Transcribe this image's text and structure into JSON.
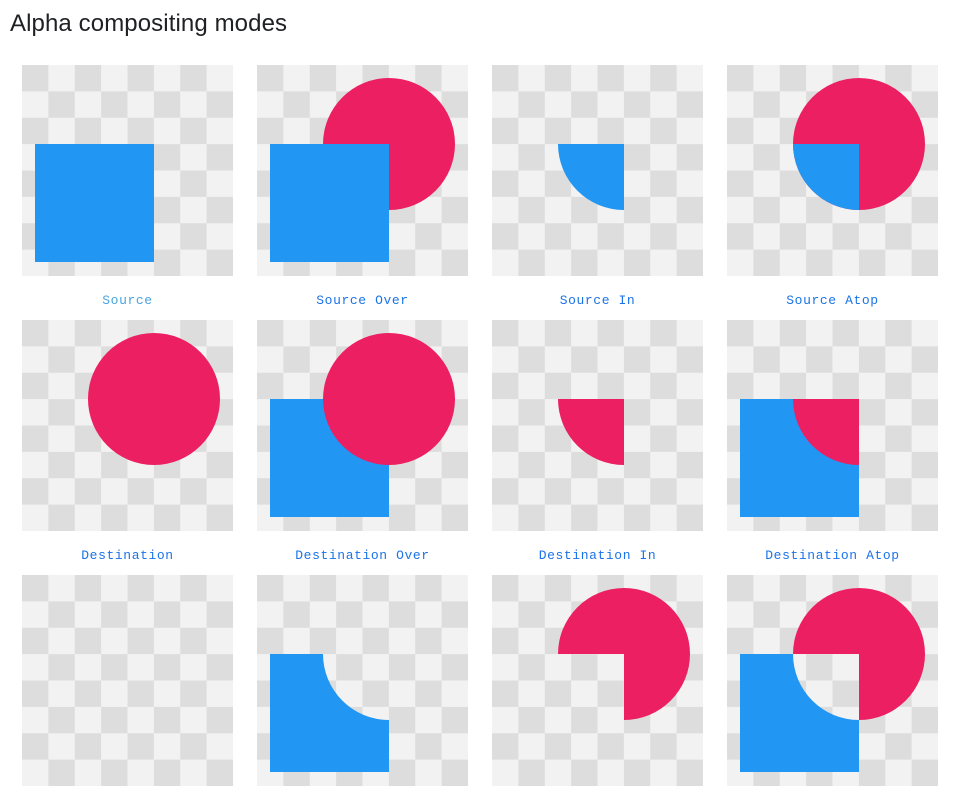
{
  "page": {
    "title": "Alpha compositing modes"
  },
  "colors": {
    "checker_light": "#f2f2f2",
    "checker_dark": "#dddddd",
    "source_square": "#2196f3",
    "destination_circle": "#ec1f63",
    "link": "#1a73e8",
    "link_muted": "#4aa3df"
  },
  "modes": [
    {
      "label": "Source",
      "link_style": "muted"
    },
    {
      "label": "Source Over",
      "link_style": "normal"
    },
    {
      "label": "Source In",
      "link_style": "normal"
    },
    {
      "label": "Source Atop",
      "link_style": "normal"
    },
    {
      "label": "Destination",
      "link_style": "normal"
    },
    {
      "label": "Destination Over",
      "link_style": "normal"
    },
    {
      "label": "Destination In",
      "link_style": "normal"
    },
    {
      "label": "Destination Atop",
      "link_style": "normal"
    },
    {
      "label": "",
      "link_style": "normal"
    },
    {
      "label": "",
      "link_style": "normal"
    },
    {
      "label": "",
      "link_style": "normal"
    },
    {
      "label": "",
      "link_style": "normal"
    }
  ]
}
